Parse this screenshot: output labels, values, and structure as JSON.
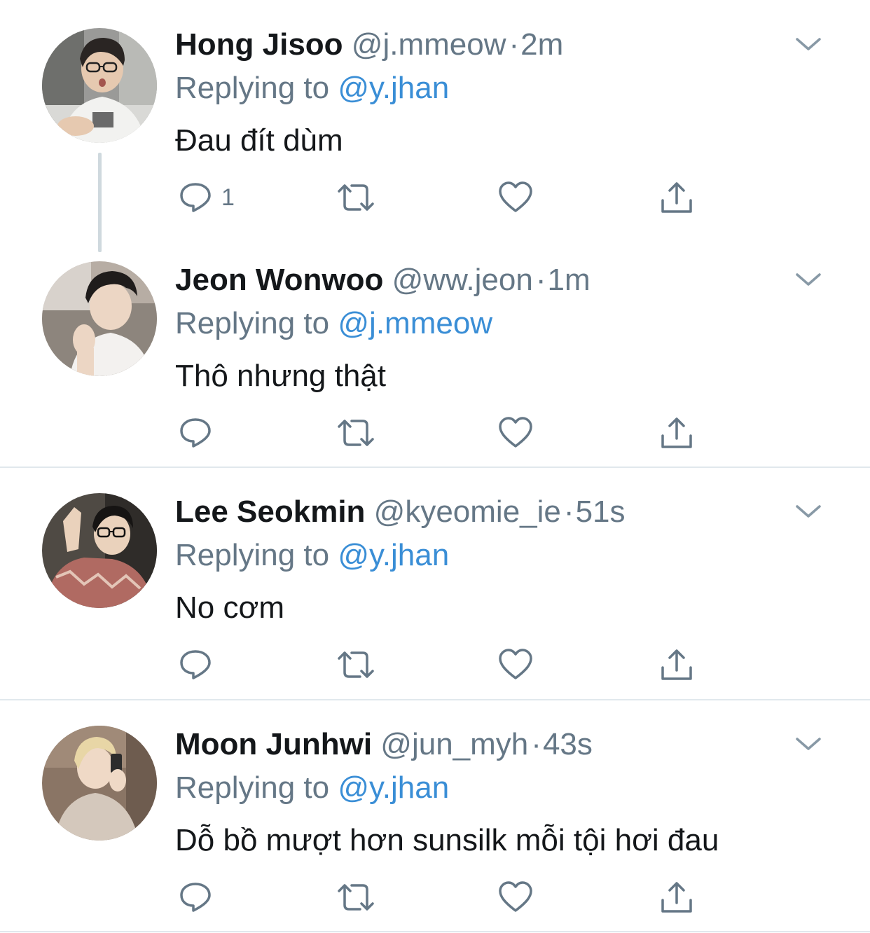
{
  "tweets": [
    {
      "name": "Hong Jisoo",
      "handle": "@j.mmeow",
      "separator": "·",
      "time": "2m",
      "replying_prefix": "Replying to",
      "replying_to": "@y.jhan",
      "text": "Đau đít dùm",
      "reply_count": "1",
      "avatar_icon": "avatar-photo"
    },
    {
      "name": "Jeon Wonwoo",
      "handle": "@ww.jeon",
      "separator": "·",
      "time": "1m",
      "replying_prefix": "Replying to",
      "replying_to": "@j.mmeow",
      "text": "Thô nhưng thật",
      "reply_count": "",
      "avatar_icon": "avatar-photo"
    },
    {
      "name": "Lee Seokmin",
      "handle": "@kyeomie_ie",
      "separator": "·",
      "time": "51s",
      "replying_prefix": "Replying to",
      "replying_to": "@y.jhan",
      "text": "No cơm",
      "reply_count": "",
      "avatar_icon": "avatar-photo"
    },
    {
      "name": "Moon Junhwi",
      "handle": "@jun_myh",
      "separator": "·",
      "time": "43s",
      "replying_prefix": "Replying to",
      "replying_to": "@y.jhan",
      "text": "Dỗ bồ mượt hơn sunsilk mỗi tội hơi đau",
      "reply_count": "",
      "avatar_icon": "avatar-photo"
    }
  ],
  "icons": {
    "reply": "reply-bubble-icon",
    "retweet": "retweet-icon",
    "like": "heart-icon",
    "share": "share-icon",
    "more": "chevron-down-icon"
  },
  "colors": {
    "text": "#14171a",
    "secondary": "#657786",
    "mention": "#3a8ed6",
    "divider": "#e1e8ed",
    "thread_line": "#cfd9de"
  }
}
